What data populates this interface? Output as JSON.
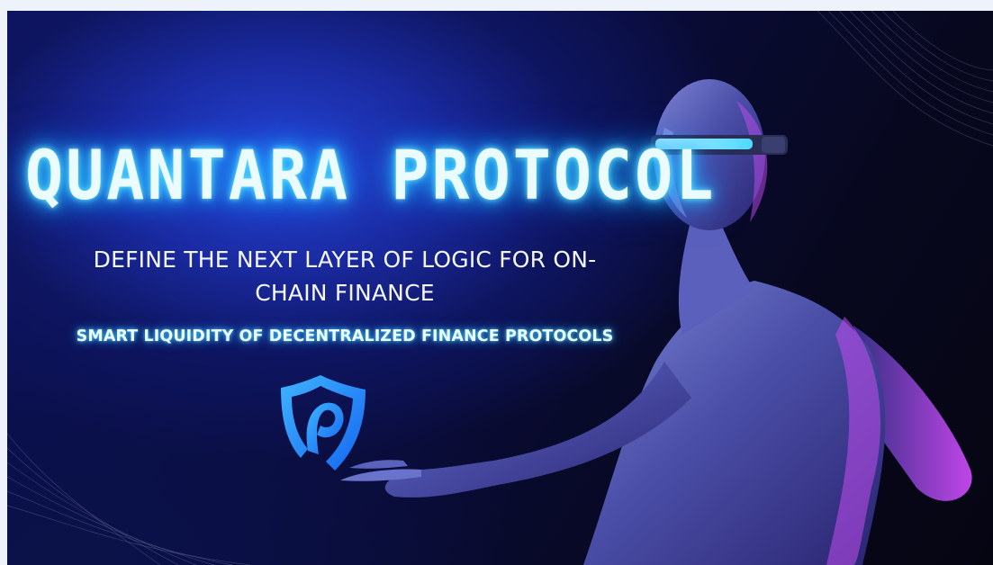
{
  "hero": {
    "title": "QUANTARA PROTOCOL",
    "subtitle": "DEFINE THE NEXT LAYER OF LOGIC FOR ON-\nCHAIN FINANCE",
    "tagline": "SMART LIQUIDITY OF DECENTRALIZED FINANCE PROTOCOLS"
  },
  "logo": {
    "icon": "shield-p-logo-icon",
    "color": "#1e8cff"
  },
  "figure": {
    "icon": "humanoid-figure-with-visor"
  },
  "colors": {
    "background": "#0b1060",
    "glow": "#2ec8ff",
    "accent_pink": "#d44cff"
  }
}
